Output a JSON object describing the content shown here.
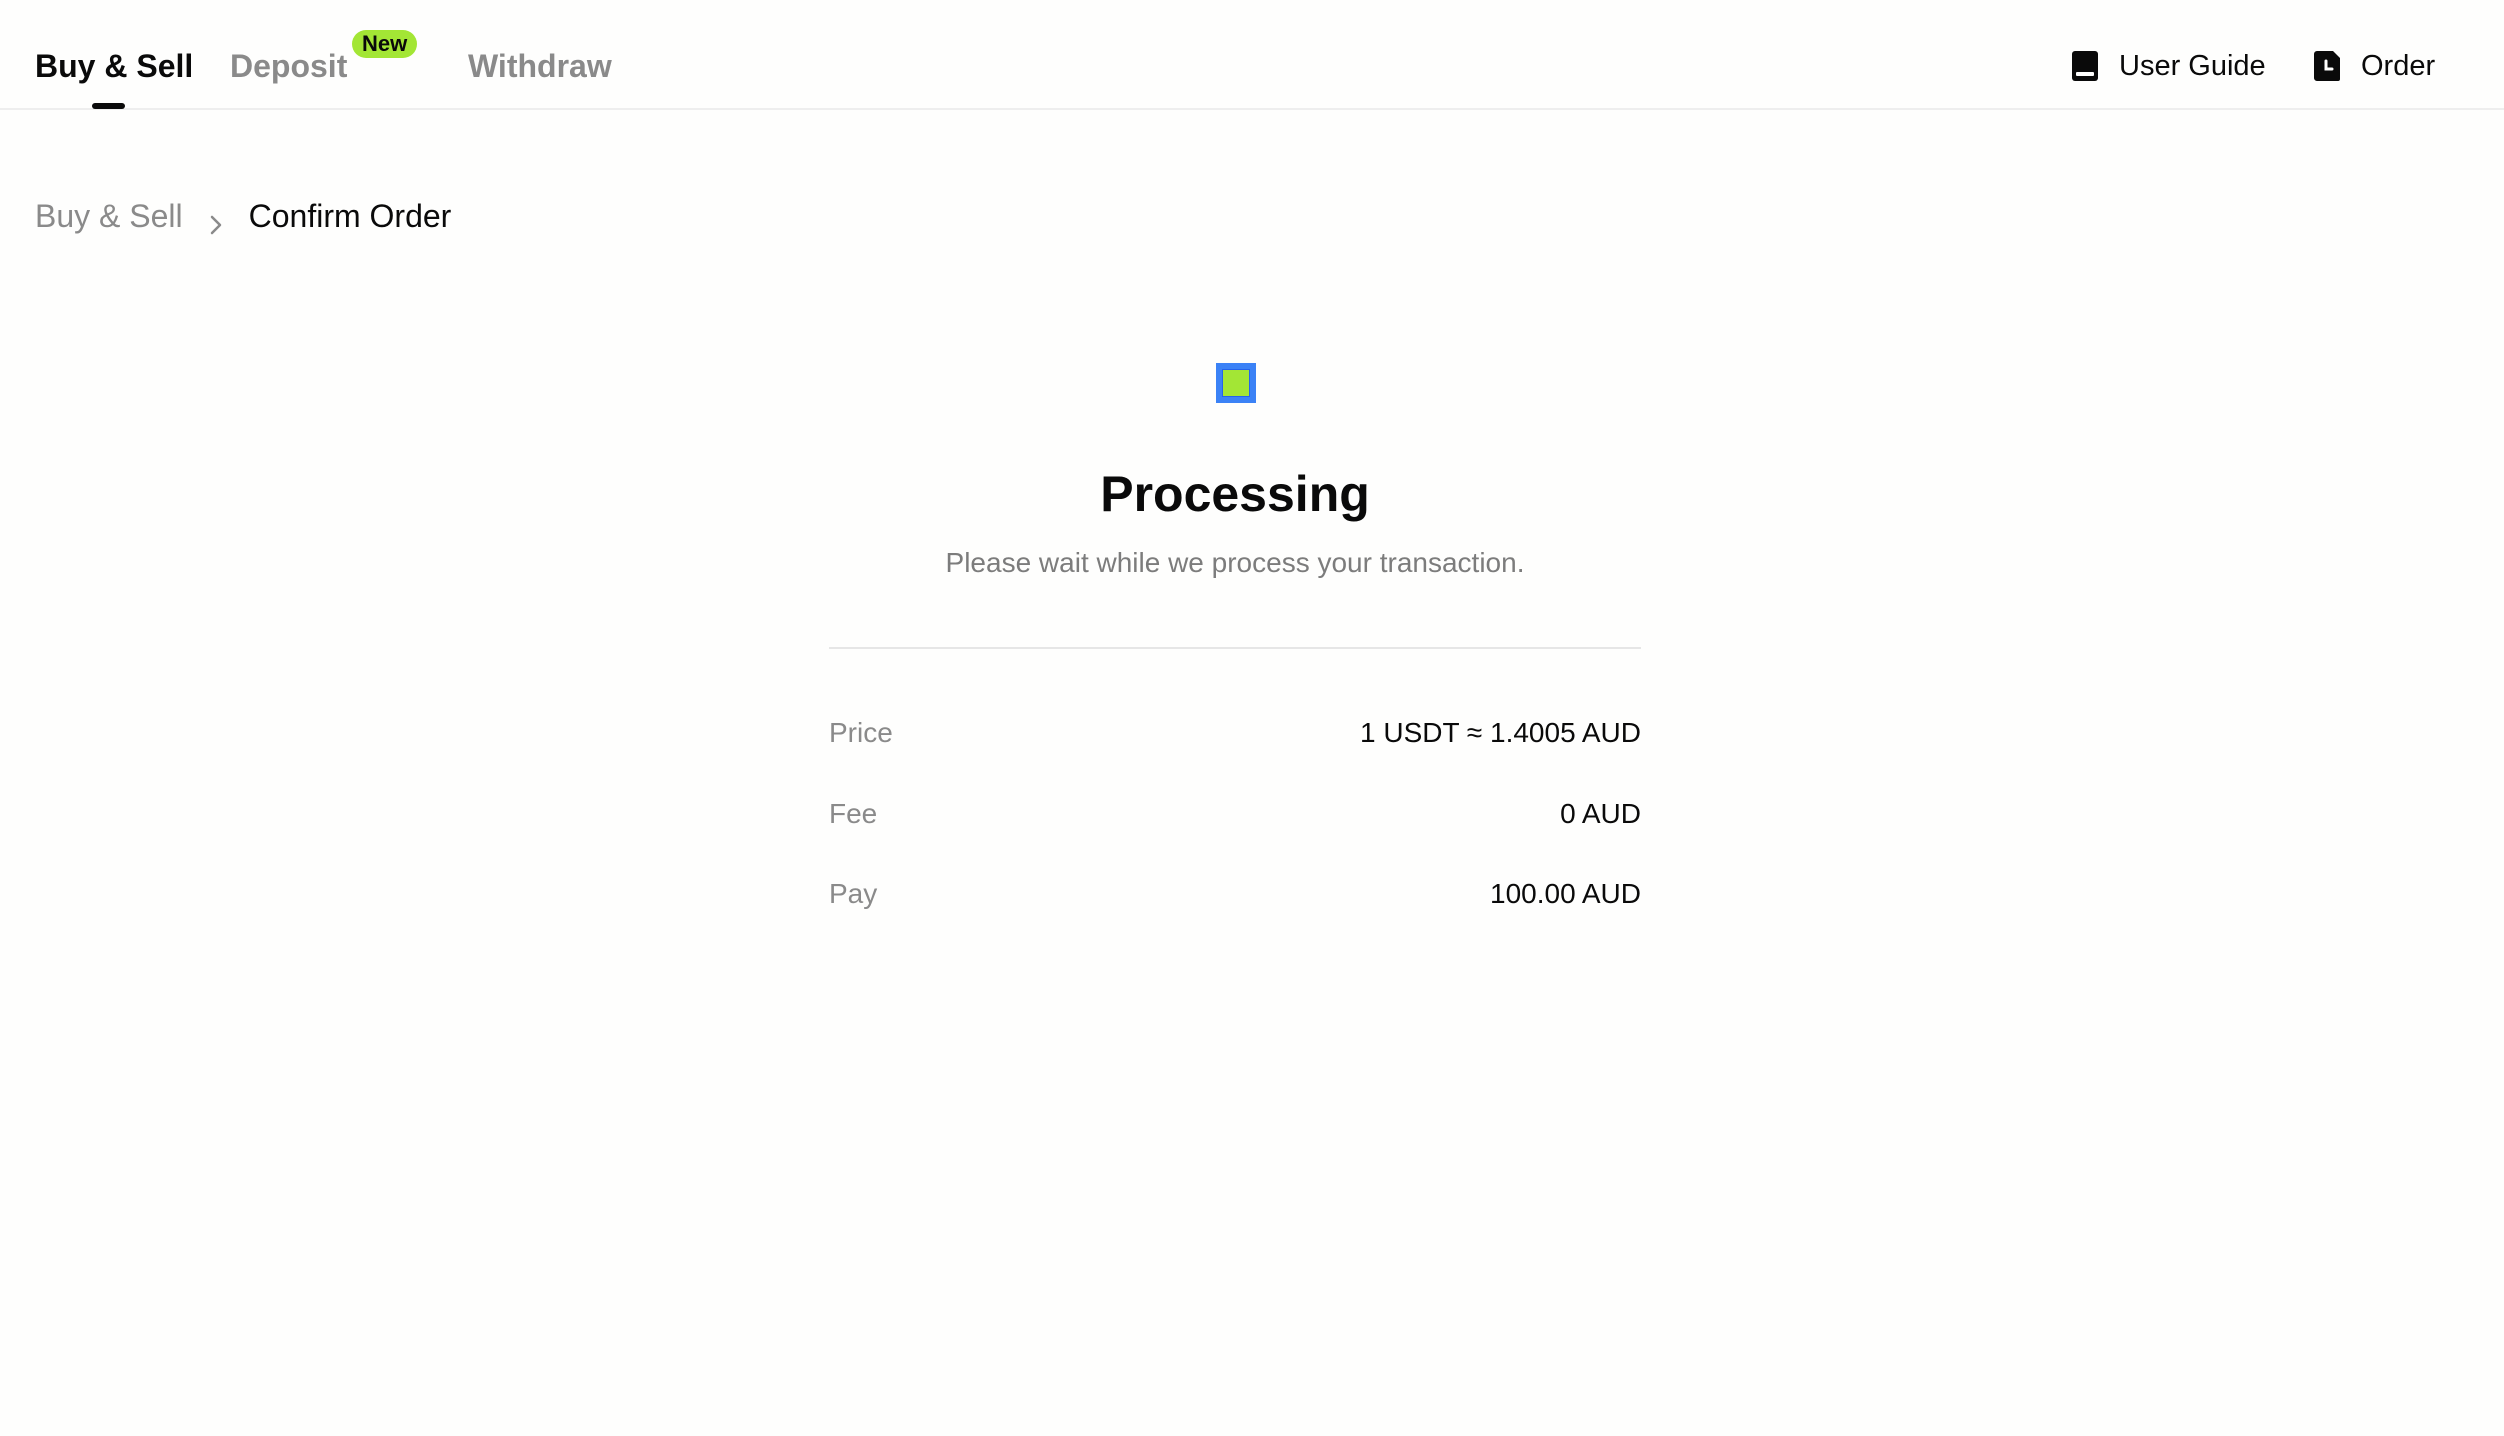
{
  "tabs": [
    {
      "label": "Buy & Sell",
      "active": true
    },
    {
      "label": "Deposit",
      "badge": "New",
      "active": false
    },
    {
      "label": "Withdraw",
      "active": false
    }
  ],
  "top_actions": {
    "user_guide": {
      "label": "User Guide",
      "icon": "book-icon"
    },
    "order": {
      "label": "Order",
      "icon": "order-history-icon"
    }
  },
  "breadcrumb": {
    "parent": "Buy & Sell",
    "separator_icon": "chevron-right-icon",
    "current": "Confirm Order"
  },
  "status": {
    "icon": "processing-loader-icon",
    "title": "Processing",
    "message": "Please wait while we process your transaction."
  },
  "summary": [
    {
      "label": "Price",
      "value": "1 USDT ≈ 1.4005 AUD"
    },
    {
      "label": "Fee",
      "value": "0 AUD"
    },
    {
      "label": "Pay",
      "value": "100.00 AUD"
    }
  ],
  "colors": {
    "accent_green": "#a3e635",
    "loader_blue": "#3b82f6",
    "text_primary": "#0a0a0a",
    "text_muted": "#8a8a8a"
  }
}
